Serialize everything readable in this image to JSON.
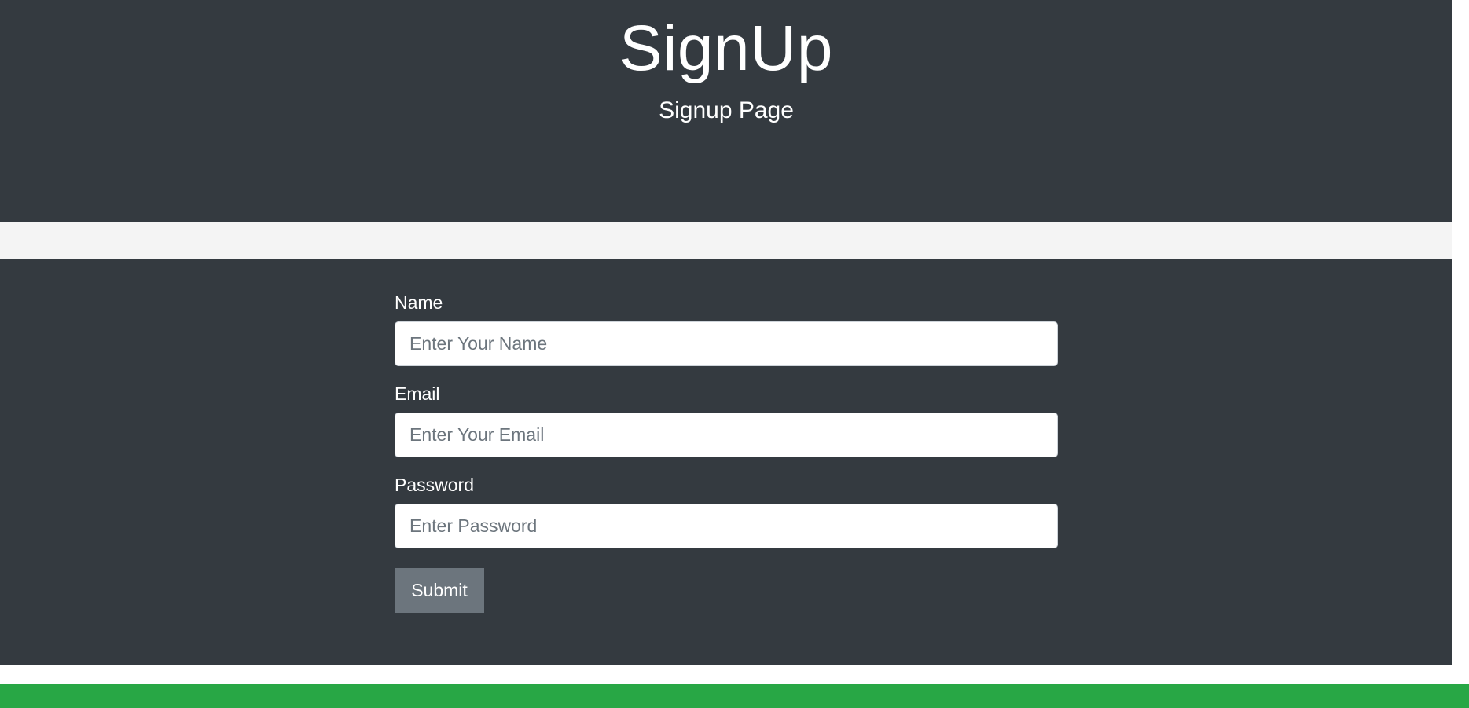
{
  "hero": {
    "title": "SignUp",
    "subtitle": "Signup Page"
  },
  "form": {
    "fields": [
      {
        "label": "Name",
        "placeholder": "Enter Your Name",
        "value": ""
      },
      {
        "label": "Email",
        "placeholder": "Enter Your Email",
        "value": ""
      },
      {
        "label": "Password",
        "placeholder": "Enter Password",
        "value": ""
      }
    ],
    "submit_label": "Submit"
  },
  "colors": {
    "dark_background": "#343a40",
    "light_background": "#f4f4f4",
    "button_gray": "#6c757d",
    "footer_green": "#28a745",
    "text_white": "#ffffff"
  }
}
